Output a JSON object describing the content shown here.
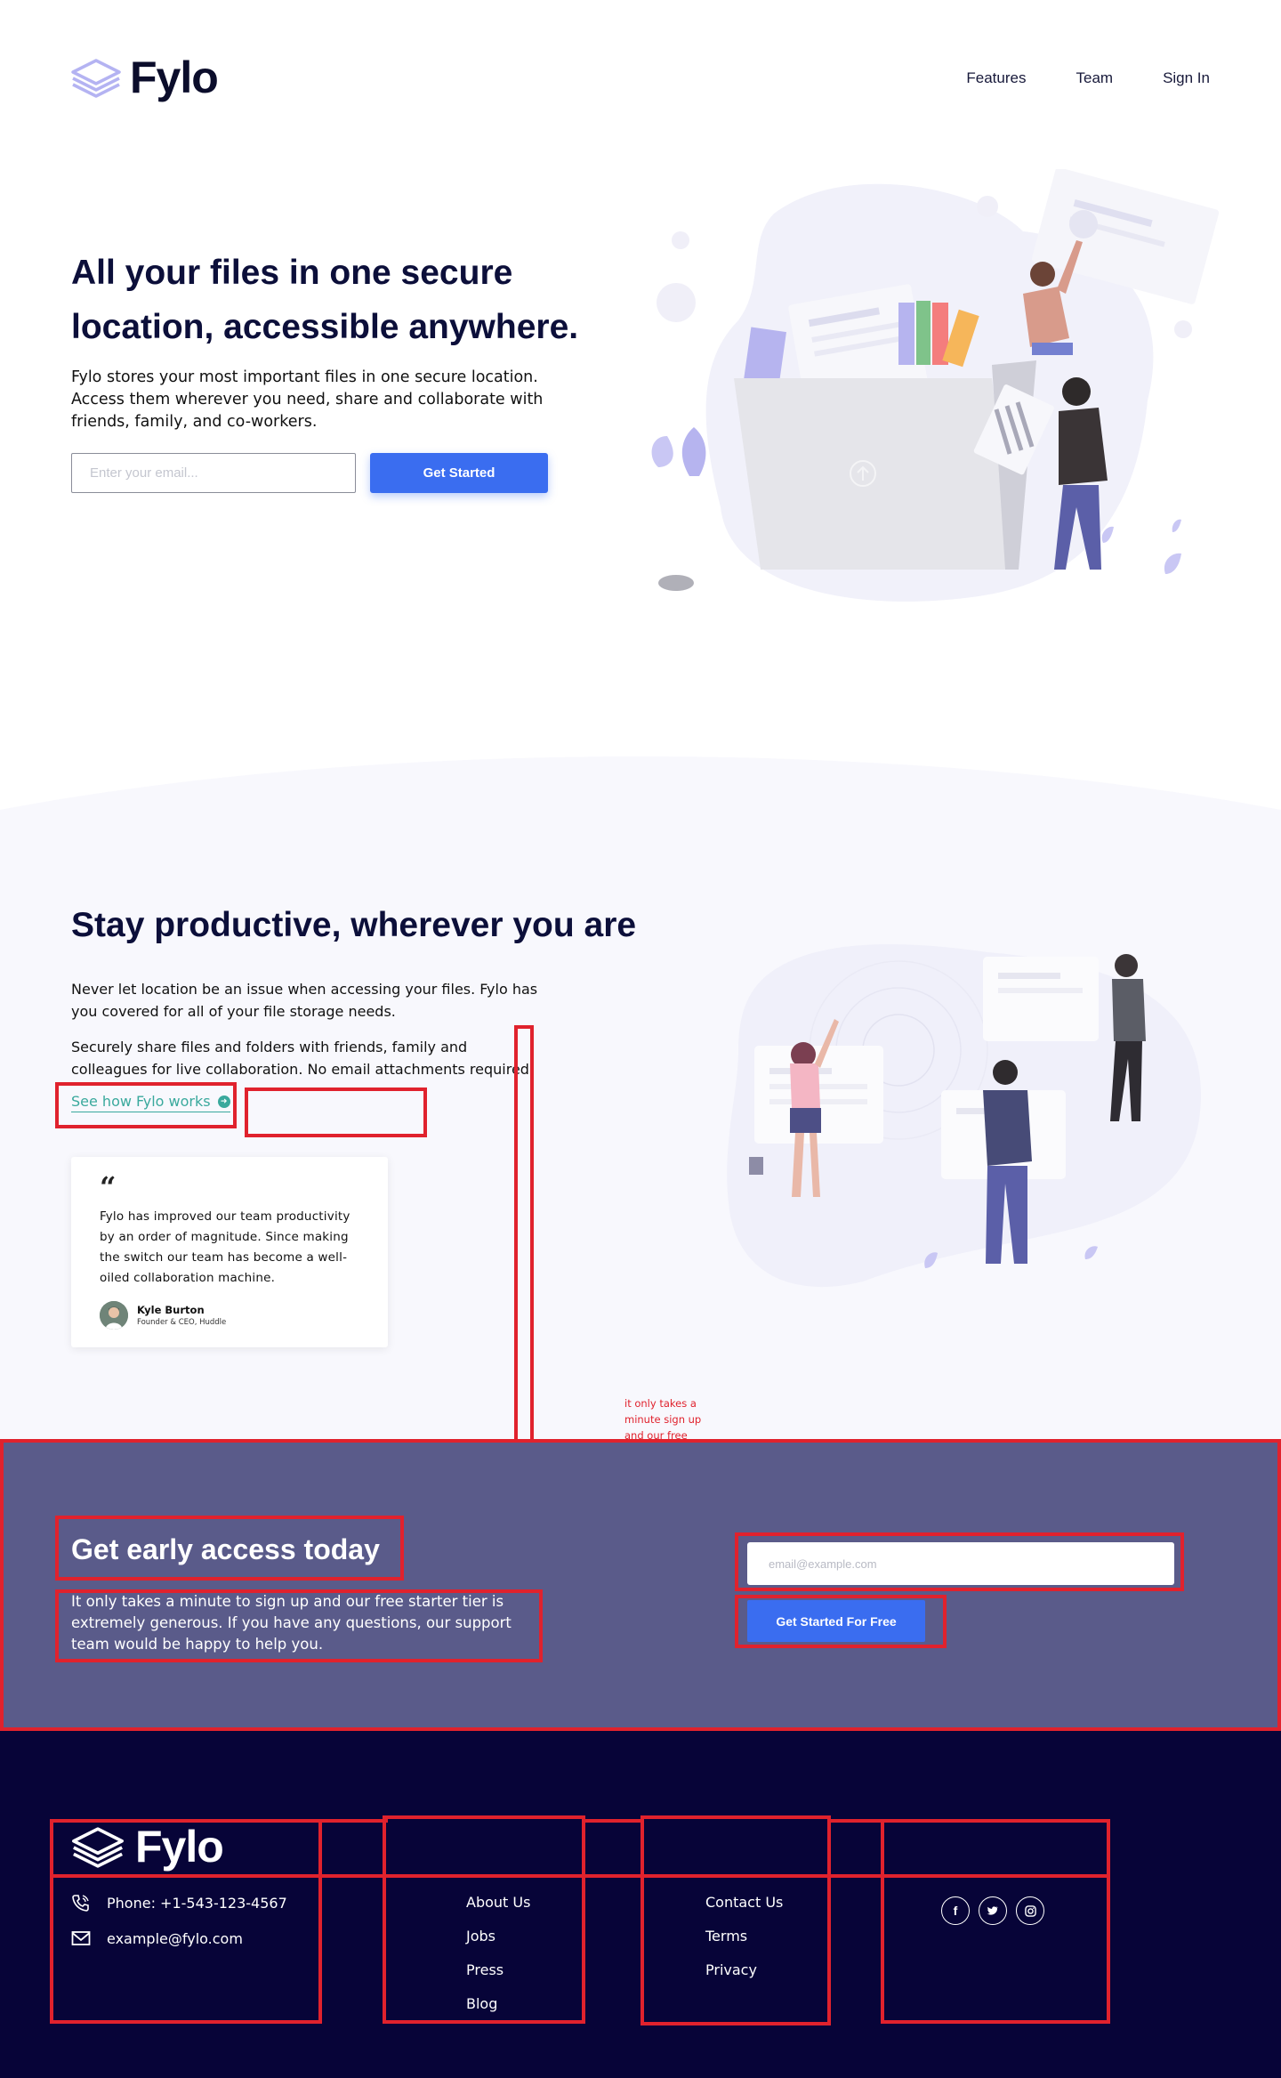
{
  "brand": {
    "name": "Fylo"
  },
  "nav": {
    "links": [
      "Features",
      "Team",
      "Sign In"
    ]
  },
  "hero": {
    "title": "All your files in one secure location, accessible anywhere.",
    "text": "Fylo stores your most important files in one secure location. Access them wherever you need, share and collaborate with friends, family, and co-workers.",
    "email_placeholder": "Enter your email...",
    "cta_label": "Get Started"
  },
  "productive": {
    "title": "Stay productive, wherever you are",
    "p1": "Never let location be an issue when accessing your files. Fylo has you covered for all of your file storage needs.",
    "p2": "Securely share files and folders with friends, family and colleagues for live collaboration. No email attachments required!",
    "link_label": "See how Fylo works"
  },
  "testimonial": {
    "quote_mark": "“",
    "text": "Fylo has improved our team productivity by an order of magnitude. Since making the switch our team has become a well-oiled collaboration machine.",
    "author_name": "Kyle Burton",
    "author_role": "Founder & CEO, Huddle"
  },
  "stray_text": "it only takes a minute sign up and our free starter tier is extremely generous. If you have any questions, our support team would be happy to help you.",
  "access": {
    "title": "Get early access today",
    "text": "It only takes a minute to sign up and our free starter tier is extremely generous. If you have any questions, our support team would be happy to help you.",
    "email_placeholder": "email@example.com",
    "cta_label": "Get Started For Free"
  },
  "footer": {
    "phone": "Phone: +1-543-123-4567",
    "email": "example@fylo.com",
    "col1": [
      "About Us",
      "Jobs",
      "Press",
      "Blog"
    ],
    "col2": [
      "Contact Us",
      "Terms",
      "Privacy"
    ],
    "socials": [
      "facebook-icon",
      "twitter-icon",
      "instagram-icon"
    ]
  },
  "colors": {
    "primary_blue": "#3a6df0",
    "heading_navy": "#0c0f3a",
    "access_bg": "#5a5b8a",
    "footer_bg": "#070438",
    "link_teal": "#3aa99d",
    "annotation_red": "#e0222d"
  }
}
